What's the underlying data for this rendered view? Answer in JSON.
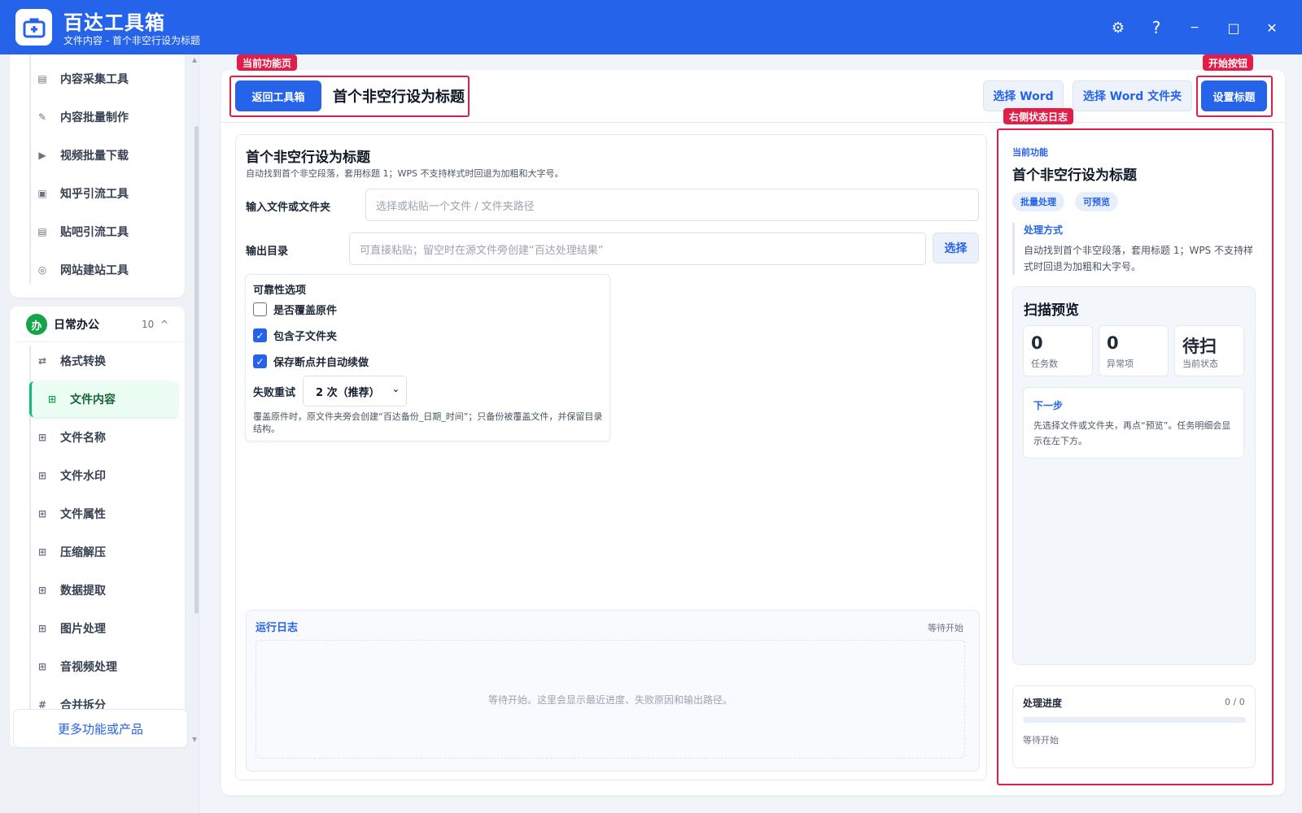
{
  "app": {
    "title": "百达工具箱",
    "subtitle": "文件内容 - 首个非空行设为标题"
  },
  "colors": {
    "primary": "#2563eb",
    "annotation": "#e11d48",
    "active_green": "#16a34a"
  },
  "window_controls": [
    {
      "name": "settings-icon",
      "glyph": "⚙"
    },
    {
      "name": "help-icon",
      "glyph": "?"
    },
    {
      "name": "minimize-icon",
      "glyph": "−"
    },
    {
      "name": "maximize-icon",
      "glyph": "□"
    },
    {
      "name": "close-icon",
      "glyph": "✕"
    }
  ],
  "sidebar": {
    "upper_items": [
      {
        "label": "内容采集工具",
        "icon": "collect-icon"
      },
      {
        "label": "内容批量制作",
        "icon": "pen-icon"
      },
      {
        "label": "视频批量下载",
        "icon": "video-icon"
      },
      {
        "label": "知乎引流工具",
        "icon": "zhihu-icon"
      },
      {
        "label": "贴吧引流工具",
        "icon": "tieba-icon"
      },
      {
        "label": "网站建站工具",
        "icon": "website-icon"
      }
    ],
    "group": {
      "badge": "办",
      "title": "日常办公",
      "count": "10",
      "toggle": "^"
    },
    "group_items": [
      {
        "label": "格式转换",
        "icon": "convert-icon",
        "glyph": "⇄"
      },
      {
        "label": "文件内容",
        "icon": "grid-icon",
        "glyph": "⊞",
        "active": true
      },
      {
        "label": "文件名称",
        "icon": "grid-icon",
        "glyph": "⊞"
      },
      {
        "label": "文件水印",
        "icon": "grid-icon",
        "glyph": "⊞"
      },
      {
        "label": "文件属性",
        "icon": "grid-icon",
        "glyph": "⊞"
      },
      {
        "label": "压缩解压",
        "icon": "grid-icon",
        "glyph": "⊞"
      },
      {
        "label": "数据提取",
        "icon": "grid-icon",
        "glyph": "⊞"
      },
      {
        "label": "图片处理",
        "icon": "grid-icon",
        "glyph": "⊞"
      },
      {
        "label": "音视频处理",
        "icon": "grid-icon",
        "glyph": "⊞"
      },
      {
        "label": "合并拆分",
        "icon": "hash-icon",
        "glyph": "#"
      }
    ],
    "more_label": "更多功能或产品"
  },
  "toolbar": {
    "back_label": "返回工具箱",
    "page_title": "首个非空行设为标题",
    "select_word_label": "选择 Word",
    "select_folder_label": "选择 Word 文件夹",
    "start_label": "设置标题"
  },
  "annotations": {
    "current_page": "当前功能页",
    "start_button": "开始按钮",
    "status_log": "右侧状态日志"
  },
  "form": {
    "title": "首个非空行设为标题",
    "description": "自动找到首个非空段落，套用标题 1；WPS 不支持样式时回退为加粗和大字号。",
    "input_label": "输入文件或文件夹",
    "input_placeholder": "选择或粘贴一个文件 / 文件夹路径",
    "output_label": "输出目录",
    "output_placeholder": "可直接粘贴；留空时在源文件旁创建“百达处理结果”",
    "output_select_label": "选择",
    "options": {
      "title": "可靠性选项",
      "overwrite": {
        "label": "是否覆盖原件",
        "checked": false
      },
      "subfolders": {
        "label": "包含子文件夹",
        "checked": true
      },
      "resume": {
        "label": "保存断点并自动续做",
        "checked": true
      },
      "retry_label": "失败重试",
      "retry_value": "2 次（推荐）",
      "note": "覆盖原件时，原文件夹旁会创建“百达备份_日期_时间”；只备份被覆盖文件，并保留目录结构。"
    }
  },
  "log": {
    "title": "运行日志",
    "status": "等待开始",
    "empty_text": "等待开始。这里会显示最近进度、失败原因和输出路径。"
  },
  "right_panel": {
    "kicker": "当前功能",
    "title": "首个非空行设为标题",
    "tags": [
      "批量处理",
      "可预览"
    ],
    "method_title": "处理方式",
    "method_text": "自动找到首个非空段落，套用标题 1；WPS 不支持样式时回退为加粗和大字号。",
    "scan": {
      "title": "扫描预览",
      "stats": [
        {
          "value": "0",
          "label": "任务数"
        },
        {
          "value": "0",
          "label": "异常项"
        },
        {
          "value": "待扫",
          "label": "当前状态"
        }
      ],
      "next_title": "下一步",
      "next_text": "先选择文件或文件夹，再点“预览”。任务明细会显示在左下方。"
    },
    "progress": {
      "title": "处理进度",
      "count": "0 / 0",
      "fraction": 0,
      "status": "等待开始"
    }
  }
}
